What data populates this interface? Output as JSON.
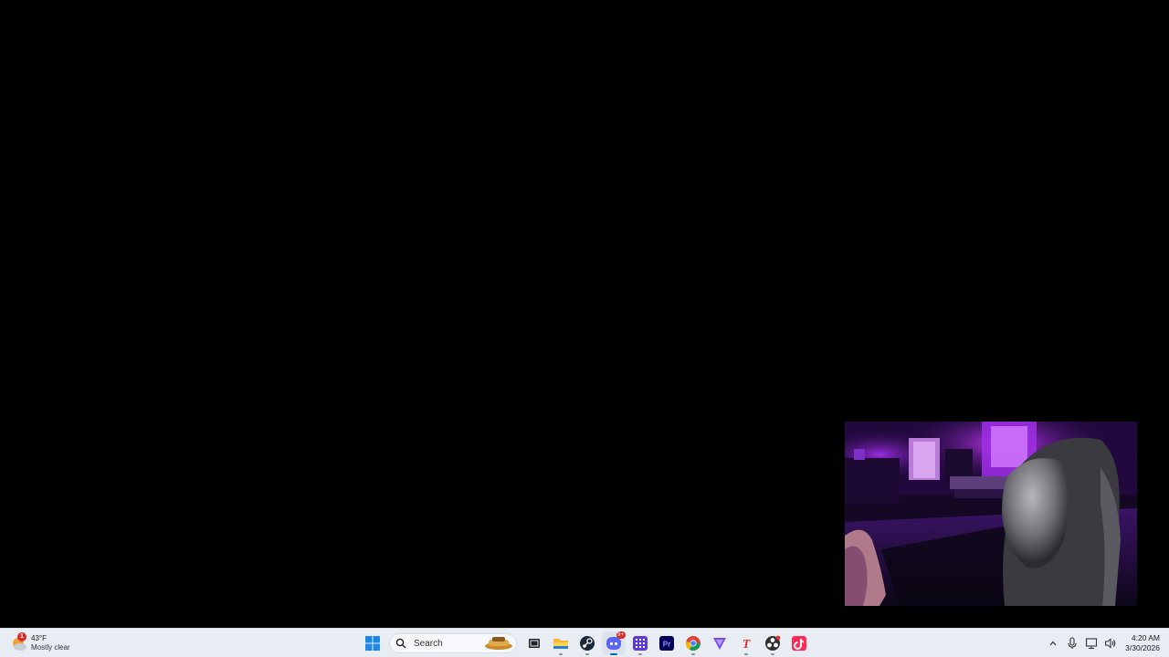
{
  "desktop": {
    "background_color": "#000000"
  },
  "webcam": {
    "description_icon": "webcam-overlay"
  },
  "taskbar": {
    "background_color": "#e8edf3",
    "accent_color": "#0067c0",
    "weather": {
      "badge_count": "1",
      "temperature": "43°F",
      "condition": "Mostly clear",
      "icon": "moon-cloud-icon"
    },
    "search": {
      "label": "Search"
    },
    "apps": [
      {
        "name": "start",
        "icon": "windows-logo-icon"
      },
      {
        "name": "task-view",
        "icon": "task-view-icon"
      },
      {
        "name": "file-explorer",
        "icon": "folder-icon"
      },
      {
        "name": "steam",
        "icon": "steam-icon"
      },
      {
        "name": "discord",
        "icon": "discord-icon",
        "badge": "9+"
      },
      {
        "name": "app-grid",
        "icon": "grid-icon"
      },
      {
        "name": "premiere-pro",
        "icon": "premiere-icon",
        "label": "Pr"
      },
      {
        "name": "chrome",
        "icon": "chrome-icon"
      },
      {
        "name": "vpn",
        "icon": "triangle-icon"
      },
      {
        "name": "text-app",
        "icon": "t-icon",
        "label": "T"
      },
      {
        "name": "obs",
        "icon": "obs-icon"
      },
      {
        "name": "tiktok",
        "icon": "tiktok-icon"
      }
    ],
    "tray": {
      "chevron_icon": "chevron-up-icon",
      "mic_icon": "microphone-icon",
      "network_icon": "network-icon",
      "volume_icon": "speaker-icon"
    },
    "clock": {
      "time": "4:20 AM",
      "date": "3/30/2026"
    }
  }
}
